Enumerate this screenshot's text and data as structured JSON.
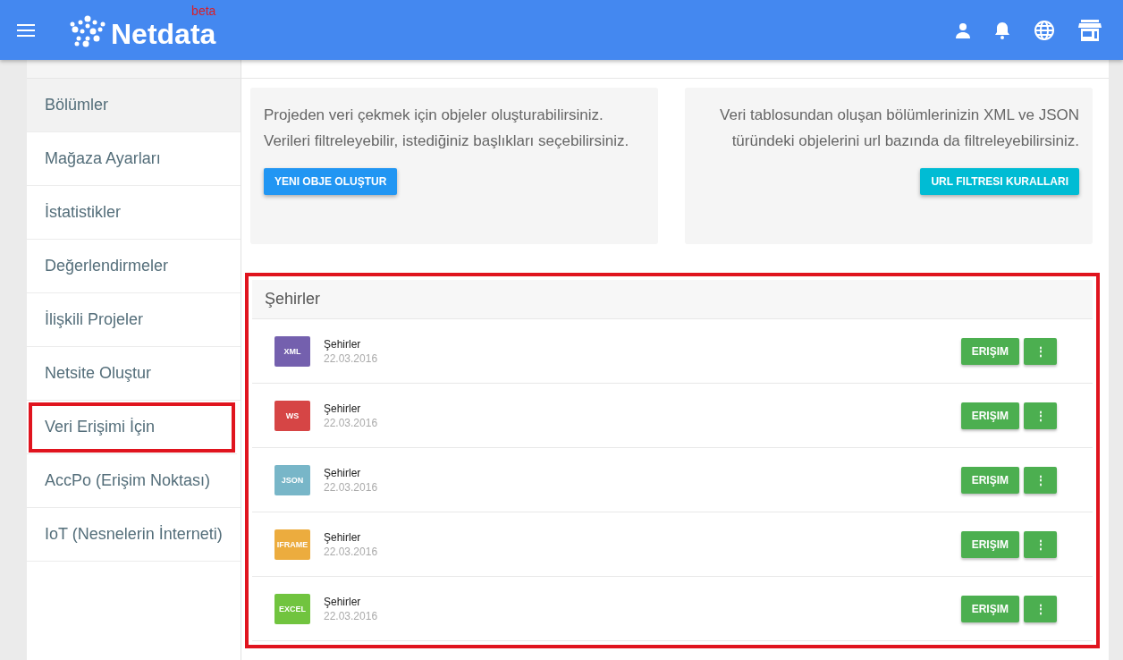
{
  "header": {
    "logo": "Netdata",
    "logo_badge": "beta"
  },
  "sidebar": {
    "items": [
      {
        "label": "Bölümler",
        "selected": true,
        "highlighted": false
      },
      {
        "label": "Mağaza Ayarları",
        "selected": false,
        "highlighted": false
      },
      {
        "label": "İstatistikler",
        "selected": false,
        "highlighted": false
      },
      {
        "label": "Değerlendirmeler",
        "selected": false,
        "highlighted": false
      },
      {
        "label": "İlişkili Projeler",
        "selected": false,
        "highlighted": false
      },
      {
        "label": "Netsite Oluştur",
        "selected": false,
        "highlighted": false
      },
      {
        "label": "Veri Erişimi İçin",
        "selected": false,
        "highlighted": true
      },
      {
        "label": "AccPo (Erişim Noktası)",
        "selected": false,
        "highlighted": false
      },
      {
        "label": "IoT (Nesnelerin İnterneti)",
        "selected": false,
        "highlighted": false
      }
    ]
  },
  "info_cards": [
    {
      "text": "Projeden veri çekmek için objeler oluşturabilirsiniz. Verileri filtreleyebilir, istediğiniz başlıkları seçebilirsiniz.",
      "button": "YENI OBJE OLUŞTUR",
      "kind": "left",
      "color": "#2196f3"
    },
    {
      "text": "Veri tablosundan oluşan bölümlerinizin XML ve JSON türündeki objelerini url bazında da filtreleyebilirsiniz.",
      "button": "URL FILTRESI KURALLARI",
      "kind": "right",
      "color": "#00bcd4"
    }
  ],
  "panel": {
    "title": "Şehirler",
    "highlighted": true,
    "items": [
      {
        "badge": "XML",
        "color": "#7460ae",
        "name": "Şehirler",
        "date": "22.03.2016",
        "action": "ERIŞIM",
        "menu": "⋮"
      },
      {
        "badge": "WS",
        "color": "#d64545",
        "name": "Şehirler",
        "date": "22.03.2016",
        "action": "ERIŞIM",
        "menu": "⋮"
      },
      {
        "badge": "JSON",
        "color": "#78b6c8",
        "name": "Şehirler",
        "date": "22.03.2016",
        "action": "ERIŞIM",
        "menu": "⋮"
      },
      {
        "badge": "IFRAME",
        "color": "#ecac3e",
        "name": "Şehirler",
        "date": "22.03.2016",
        "action": "ERIŞIM",
        "menu": "⋮"
      },
      {
        "badge": "EXCEL",
        "color": "#71c43f",
        "name": "Şehirler",
        "date": "22.03.2016",
        "action": "ERIŞIM",
        "menu": "⋮"
      }
    ]
  }
}
